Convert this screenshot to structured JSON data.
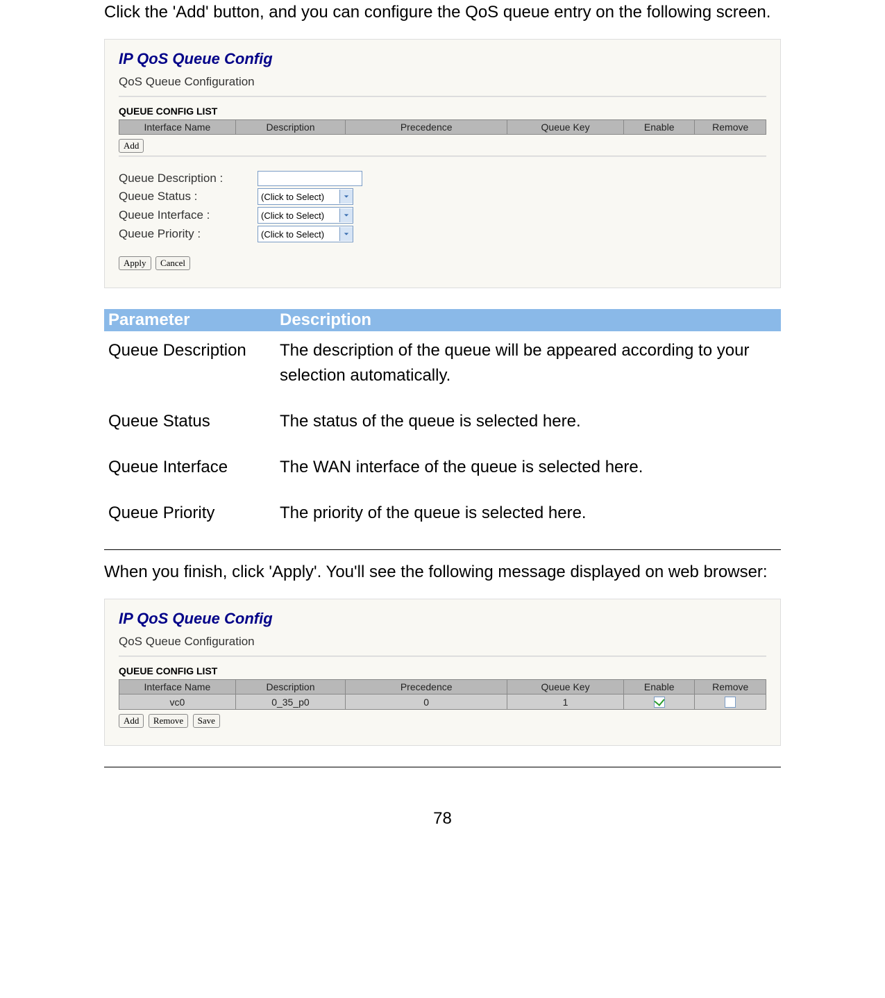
{
  "intro": "Click the 'Add' button, and you can configure the QoS queue entry on the following screen.",
  "screenshot1": {
    "title": "IP QoS Queue Config",
    "subtitle": "QoS Queue Configuration",
    "section_title": "QUEUE CONFIG LIST",
    "headers": [
      "Interface Name",
      "Description",
      "Precedence",
      "Queue Key",
      "Enable",
      "Remove"
    ],
    "add_btn": "Add",
    "form": {
      "desc_label": "Queue Description :",
      "status_label": "Queue Status :",
      "interface_label": "Queue Interface :",
      "priority_label": "Queue Priority :",
      "status_placeholder": "(Click to Select)",
      "interface_placeholder": "(Click to Select)",
      "priority_placeholder": "(Click to Select)"
    },
    "apply_btn": "Apply",
    "cancel_btn": "Cancel"
  },
  "param_table": {
    "header_param": "Parameter",
    "header_desc": "Description",
    "rows": [
      {
        "param": "Queue Description",
        "desc": "The description of the queue will be appeared according to your selection automatically."
      },
      {
        "param": "Queue Status",
        "desc": "The status of the queue is selected here."
      },
      {
        "param": "Queue Interface",
        "desc": "The WAN interface of the queue is selected here."
      },
      {
        "param": "Queue Priority",
        "desc": "The priority of the queue is selected here."
      }
    ]
  },
  "outro": "When you finish, click 'Apply'. You'll see the following message displayed on web browser:",
  "screenshot2": {
    "title": "IP QoS Queue Config",
    "subtitle": "QoS Queue Configuration",
    "section_title": "QUEUE CONFIG LIST",
    "headers": [
      "Interface Name",
      "Description",
      "Precedence",
      "Queue Key",
      "Enable",
      "Remove"
    ],
    "row": {
      "iface": "vc0",
      "desc": "0_35_p0",
      "prec": "0",
      "key": "1",
      "enable_checked": true,
      "remove_checked": false
    },
    "add_btn": "Add",
    "remove_btn": "Remove",
    "save_btn": "Save"
  },
  "page_number": "78"
}
